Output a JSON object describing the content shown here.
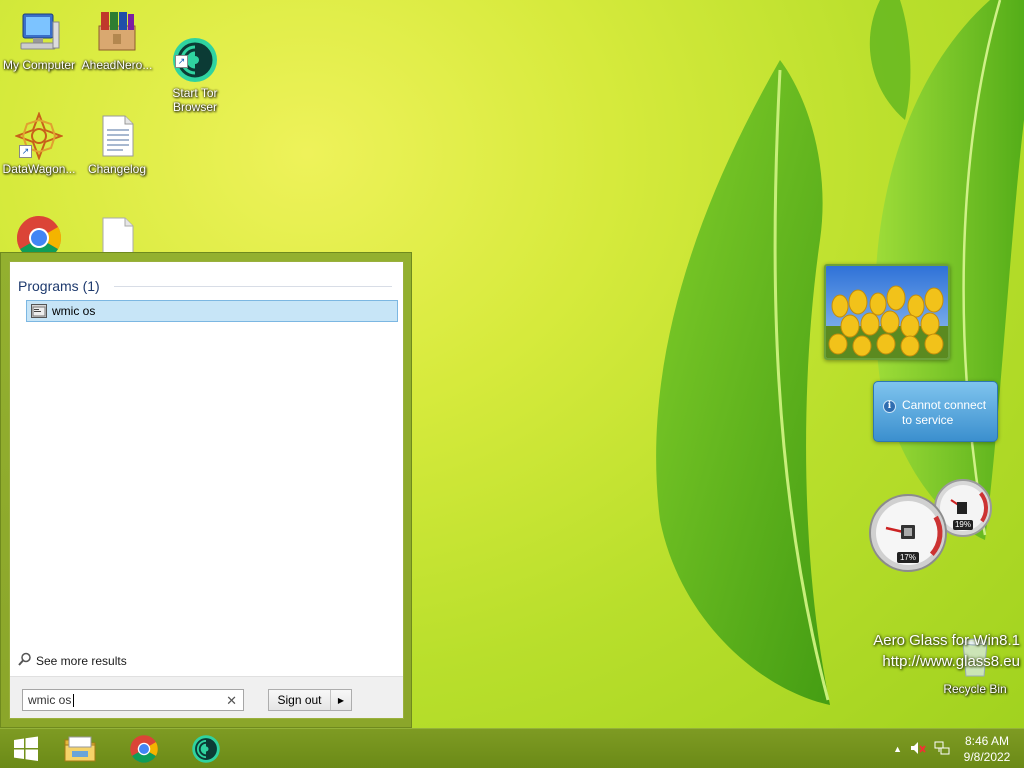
{
  "desktop": {
    "icons": [
      {
        "label": "My Computer",
        "icon": "computer-icon"
      },
      {
        "label": "AheadNero...",
        "icon": "winrar-icon"
      },
      {
        "label": "Start Tor\nBrowser",
        "icon": "tor-browser-icon"
      },
      {
        "label": "DataWagon...",
        "icon": "datawagon-icon"
      },
      {
        "label": "Changelog",
        "icon": "text-document-icon"
      },
      {
        "label": "",
        "icon": "chrome-icon"
      },
      {
        "label": "",
        "icon": "blank-document-icon"
      },
      {
        "label": "Recycle Bin",
        "icon": "recycle-bin-icon"
      }
    ]
  },
  "start_menu": {
    "programs_header": "Programs (1)",
    "results": [
      {
        "label": "wmic os",
        "icon": "command-prompt-icon"
      }
    ],
    "see_more": "See more results",
    "search": {
      "value": "wmic os",
      "clear_symbol": "✕"
    },
    "sign_out": "Sign out"
  },
  "gadgets": {
    "notice": {
      "line1": "Cannot connect",
      "line2": "to service"
    },
    "cpu_meter": {
      "cpu_percent": "17%",
      "memory_percent": "19%"
    }
  },
  "watermark": {
    "line1": "Aero Glass for Win8.1",
    "line2": "http://www.glass8.eu"
  },
  "taskbar": {
    "pinned": [
      {
        "name": "file-explorer",
        "icon": "file-explorer-icon"
      },
      {
        "name": "chrome",
        "icon": "chrome-icon"
      },
      {
        "name": "tor-browser",
        "icon": "tor-browser-icon"
      }
    ],
    "clock": {
      "time": "8:46 AM",
      "date": "9/8/2022"
    }
  },
  "colors": {
    "taskbar": "#7e9b23",
    "start_menu_frame": "#93b02f",
    "selection": "#c7e5f7",
    "notice_gadget": "#3b8fce"
  }
}
